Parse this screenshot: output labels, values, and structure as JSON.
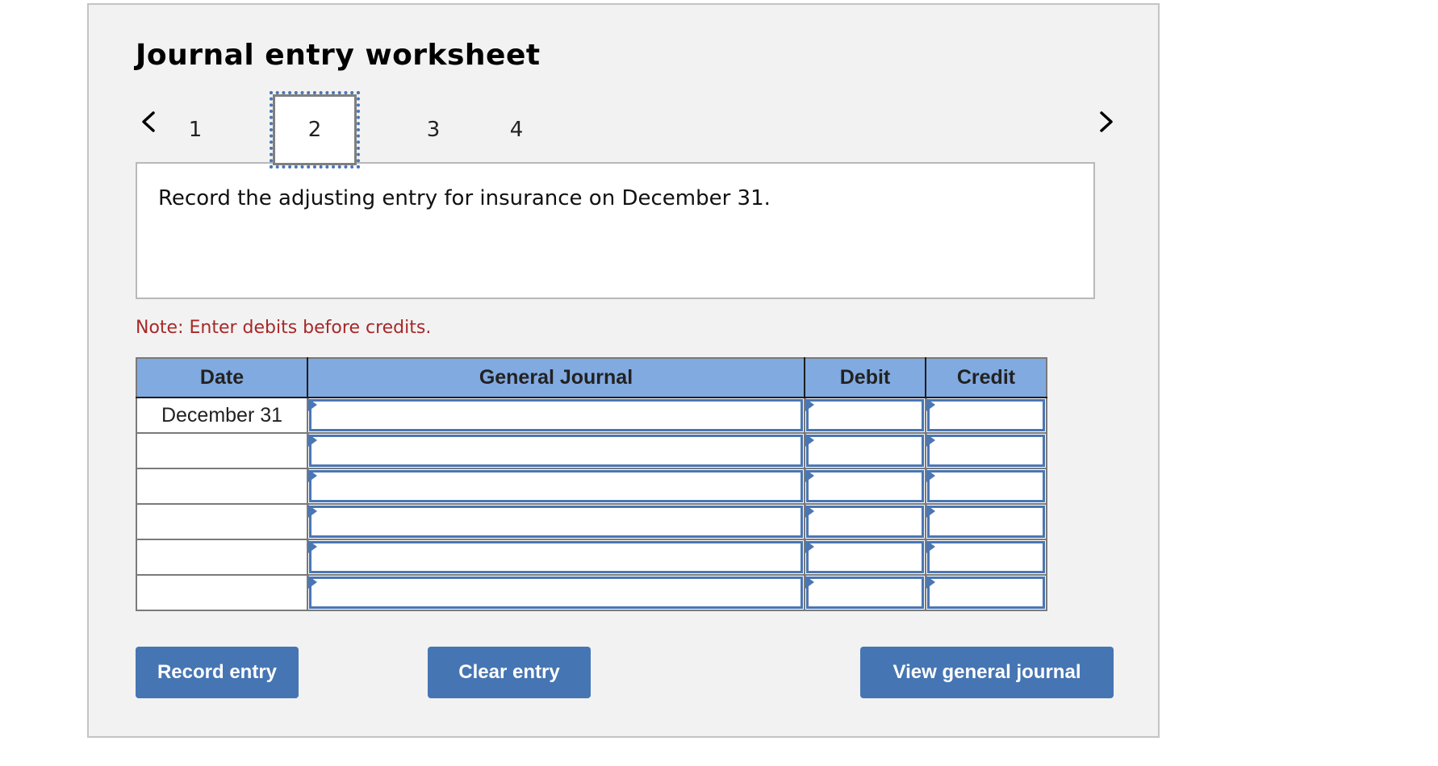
{
  "header": {
    "title": "Journal entry worksheet"
  },
  "navigation": {
    "prev_icon": "chevron-left-icon",
    "next_icon": "chevron-right-icon",
    "tabs": [
      {
        "label": "1",
        "active": false
      },
      {
        "label": "2",
        "active": true
      },
      {
        "label": "3",
        "active": false
      },
      {
        "label": "4",
        "active": false
      }
    ]
  },
  "prompt": {
    "text": "Record the adjusting entry for insurance on December 31."
  },
  "note": {
    "text": "Note: Enter debits before credits.",
    "color": "#a82828"
  },
  "table": {
    "headers": {
      "date": "Date",
      "general_journal": "General Journal",
      "debit": "Debit",
      "credit": "Credit"
    },
    "header_color": "#81aae0",
    "rows": [
      {
        "date": "December 31",
        "account": "",
        "debit": "",
        "credit": ""
      },
      {
        "date": "",
        "account": "",
        "debit": "",
        "credit": ""
      },
      {
        "date": "",
        "account": "",
        "debit": "",
        "credit": ""
      },
      {
        "date": "",
        "account": "",
        "debit": "",
        "credit": ""
      },
      {
        "date": "",
        "account": "",
        "debit": "",
        "credit": ""
      },
      {
        "date": "",
        "account": "",
        "debit": "",
        "credit": ""
      }
    ]
  },
  "buttons": {
    "record": "Record entry",
    "clear": "Clear entry",
    "view": "View general journal",
    "color": "#4675b3"
  }
}
